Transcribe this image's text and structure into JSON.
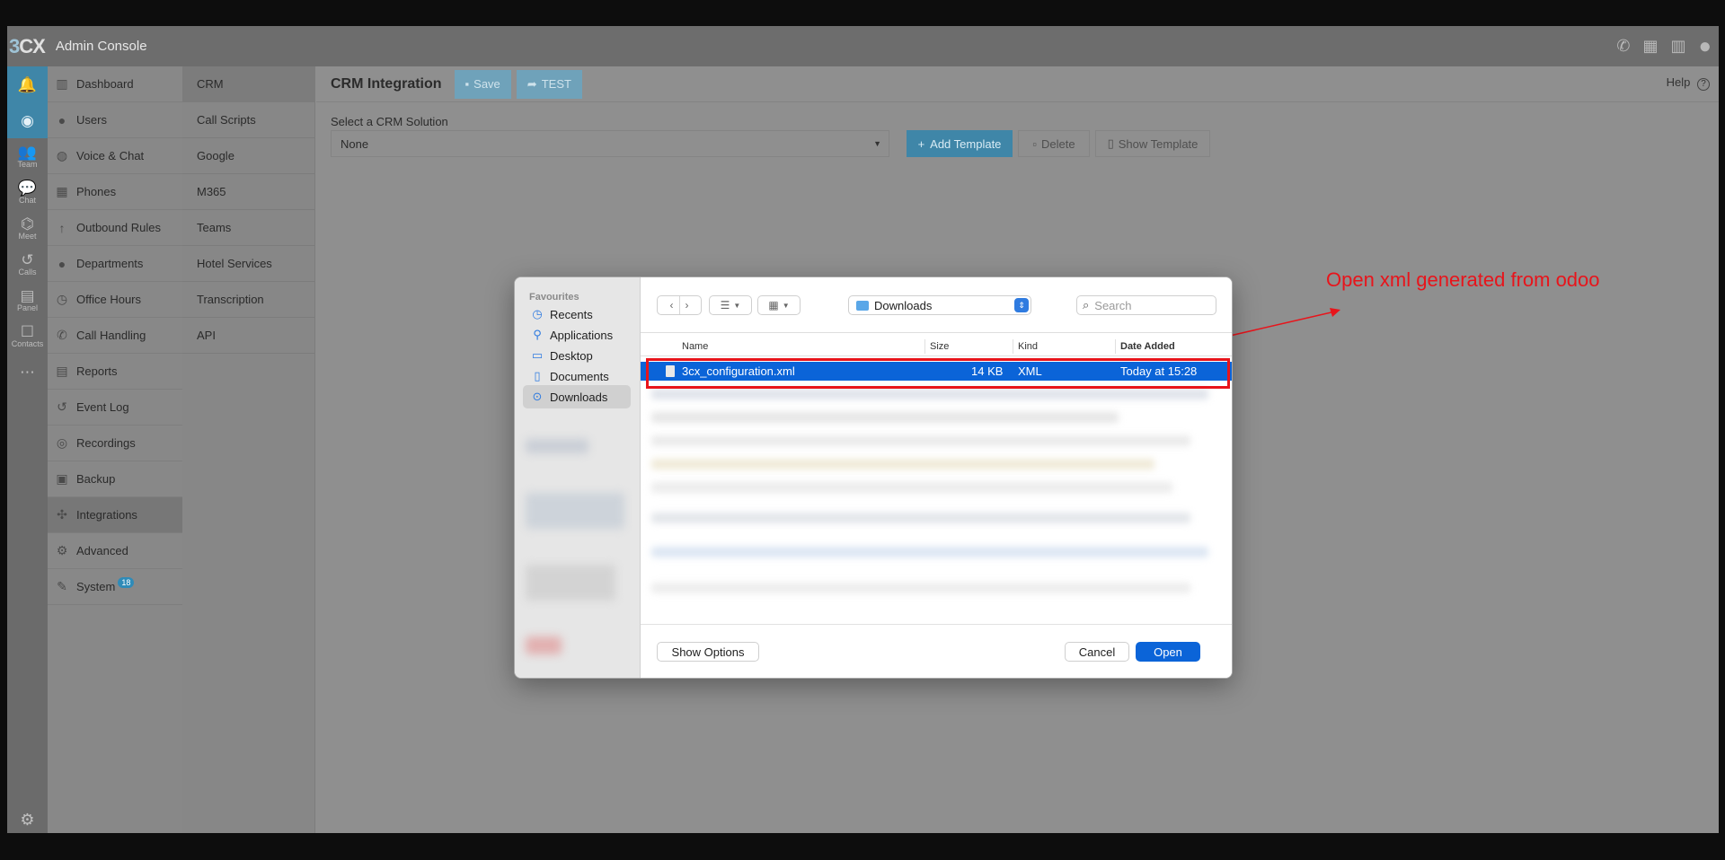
{
  "app": {
    "logo": "3CX",
    "title": "Admin Console"
  },
  "rail": [
    {
      "icon": "bell-icon",
      "glyph": "🔔",
      "label": ""
    },
    {
      "icon": "chrome-icon",
      "glyph": "◉",
      "label": ""
    },
    {
      "icon": "team-icon",
      "glyph": "👥",
      "label": "Team"
    },
    {
      "icon": "chat-icon",
      "glyph": "💬",
      "label": "Chat"
    },
    {
      "icon": "meet-icon",
      "glyph": "⌬",
      "label": "Meet"
    },
    {
      "icon": "calls-icon",
      "glyph": "↺",
      "label": "Calls"
    },
    {
      "icon": "panel-icon",
      "glyph": "▤",
      "label": "Panel"
    },
    {
      "icon": "contacts-icon",
      "glyph": "☐",
      "label": "Contacts"
    },
    {
      "icon": "more-icon",
      "glyph": "⋯",
      "label": ""
    }
  ],
  "nav": {
    "items": [
      {
        "label": "Dashboard",
        "glyph": "▥",
        "icon": "dashboard-icon"
      },
      {
        "label": "Users",
        "glyph": "●",
        "icon": "user-icon"
      },
      {
        "label": "Voice & Chat",
        "glyph": "◍",
        "icon": "globe-icon"
      },
      {
        "label": "Phones",
        "glyph": "▦",
        "icon": "phone-grid-icon"
      },
      {
        "label": "Outbound Rules",
        "glyph": "↑",
        "icon": "arrow-up-icon"
      },
      {
        "label": "Departments",
        "glyph": "●",
        "icon": "departments-icon"
      },
      {
        "label": "Office Hours",
        "glyph": "◷",
        "icon": "clock-icon"
      },
      {
        "label": "Call Handling",
        "glyph": "✆",
        "icon": "call-handling-icon"
      },
      {
        "label": "Reports",
        "glyph": "▤",
        "icon": "reports-icon"
      },
      {
        "label": "Event Log",
        "glyph": "↺",
        "icon": "event-log-icon"
      },
      {
        "label": "Recordings",
        "glyph": "◎",
        "icon": "recordings-icon"
      },
      {
        "label": "Backup",
        "glyph": "▣",
        "icon": "backup-icon"
      },
      {
        "label": "Integrations",
        "glyph": "✣",
        "icon": "puzzle-icon"
      },
      {
        "label": "Advanced",
        "glyph": "⚙",
        "icon": "gear-icon"
      },
      {
        "label": "System",
        "glyph": "✎",
        "icon": "wrench-icon",
        "badge": "18"
      }
    ]
  },
  "subnav": {
    "items": [
      "CRM",
      "Call Scripts",
      "Google",
      "M365",
      "Teams",
      "Hotel Services",
      "Transcription",
      "API"
    ]
  },
  "content": {
    "title": "CRM Integration",
    "save_label": "Save",
    "test_label": "TEST",
    "help_label": "Help",
    "crm_label": "Select a CRM Solution",
    "crm_value": "None",
    "add_template_label": "Add Template",
    "delete_label": "Delete",
    "show_template_label": "Show Template"
  },
  "annotation": {
    "text": "Open xml generated from odoo",
    "color": "#e8141b"
  },
  "dialog": {
    "favourites_heading": "Favourites",
    "favourites": [
      {
        "label": "Recents",
        "glyph": "◷",
        "icon": "recents-icon"
      },
      {
        "label": "Applications",
        "glyph": "⚲",
        "icon": "applications-icon"
      },
      {
        "label": "Desktop",
        "glyph": "▭",
        "icon": "desktop-icon"
      },
      {
        "label": "Documents",
        "glyph": "▯",
        "icon": "documents-icon"
      },
      {
        "label": "Downloads",
        "glyph": "⊙",
        "icon": "downloads-icon"
      }
    ],
    "location": "Downloads",
    "search_placeholder": "Search",
    "columns": {
      "name": "Name",
      "size": "Size",
      "kind": "Kind",
      "date": "Date Added"
    },
    "selected_file": {
      "name": "3cx_configuration.xml",
      "size": "14 KB",
      "kind": "XML",
      "date": "Today at 15:28"
    },
    "show_options_label": "Show Options",
    "cancel_label": "Cancel",
    "open_label": "Open"
  },
  "colors": {
    "accent": "#3f86a8",
    "selection": "#0b64d8",
    "annotation": "#e8141b"
  }
}
